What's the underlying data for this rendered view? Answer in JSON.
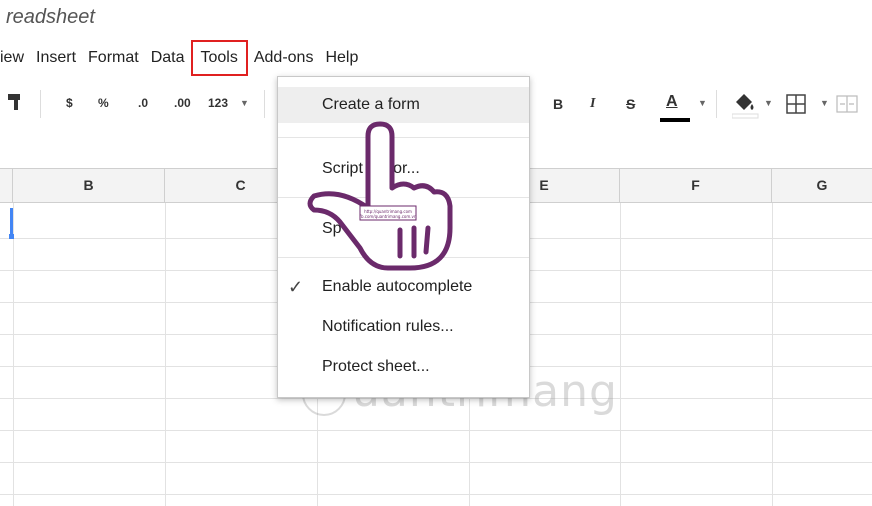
{
  "doc": {
    "title": "readsheet"
  },
  "menu": {
    "view": "iew",
    "insert": "Insert",
    "format": "Format",
    "data": "Data",
    "tools": "Tools",
    "addons": "Add-ons",
    "help": "Help"
  },
  "toolbar": {
    "currency": "$",
    "percent": "%",
    "dec_decrease": ".0",
    "dec_increase": ".00",
    "more_formats": "123",
    "bold": "B",
    "italic": "I",
    "strike": "S",
    "text_color": "A"
  },
  "columns": [
    "B",
    "C",
    "E",
    "F",
    "G"
  ],
  "tools_menu": {
    "create_form": "Create a form",
    "script_editor": "Script editor...",
    "spreadsheet_settings": "Sp",
    "enable_autocomplete": "Enable autocomplete",
    "notification_rules": "Notification rules...",
    "protect_sheet": "Protect sheet...",
    "autocomplete_checked": "✓"
  },
  "watermark": {
    "text": "uantrimang"
  },
  "colors": {
    "highlight_border": "#e02020",
    "selection": "#4285f4",
    "hand": "#6b2a6b"
  }
}
